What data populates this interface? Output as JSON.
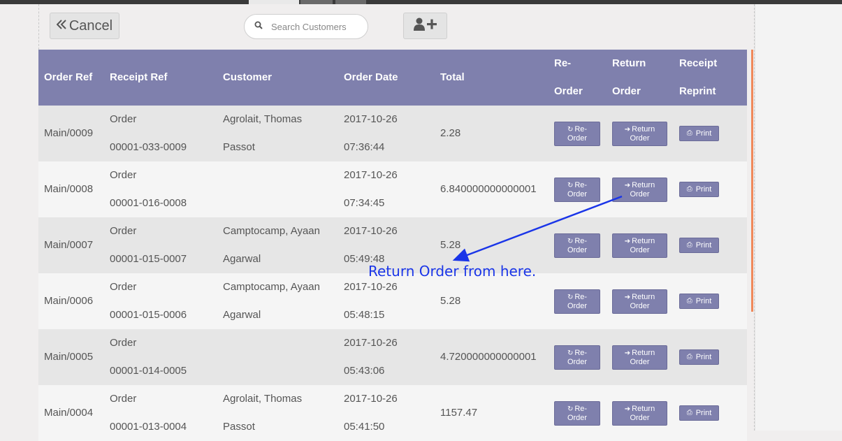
{
  "toolbar": {
    "cancel_label": "Cancel",
    "search_placeholder": "Search Customers",
    "search_value": ""
  },
  "icons": {
    "cancel": "double-chevron-left-icon",
    "search": "search-icon",
    "add_user": "user-plus-icon",
    "reorder": "refresh-icon",
    "return": "sign-in-icon",
    "print": "print-icon"
  },
  "colors": {
    "header_bg": "#7f80ad",
    "row_odd": "#e6e6e6",
    "row_even": "#f5f5f5",
    "annotation": "#1a35e8",
    "accent_bar": "#f0885a"
  },
  "table": {
    "headers": {
      "order_ref": "Order Ref",
      "receipt_ref": "Receipt Ref",
      "customer": "Customer",
      "order_date": "Order Date",
      "total": "Total",
      "reorder_1": "Re-",
      "reorder_2": "Order",
      "return_1": "Return",
      "return_2": "Order",
      "reprint_1": "Receipt",
      "reprint_2": "Reprint"
    },
    "rows": [
      {
        "order_ref": "Main/0009",
        "receipt_1": "Order",
        "receipt_2": "00001-033-0009",
        "customer_1": "Agrolait, Thomas",
        "customer_2": "Passot",
        "date_1": "2017-10-26",
        "date_2": "07:36:44",
        "total": "2.28"
      },
      {
        "order_ref": "Main/0008",
        "receipt_1": "Order",
        "receipt_2": "00001-016-0008",
        "customer_1": "",
        "customer_2": "",
        "date_1": "2017-10-26",
        "date_2": "07:34:45",
        "total": "6.840000000000001"
      },
      {
        "order_ref": "Main/0007",
        "receipt_1": "Order",
        "receipt_2": "00001-015-0007",
        "customer_1": "Camptocamp, Ayaan",
        "customer_2": "Agarwal",
        "date_1": "2017-10-26",
        "date_2": "05:49:48",
        "total": "5.28"
      },
      {
        "order_ref": "Main/0006",
        "receipt_1": "Order",
        "receipt_2": "00001-015-0006",
        "customer_1": "Camptocamp, Ayaan",
        "customer_2": "Agarwal",
        "date_1": "2017-10-26",
        "date_2": "05:48:15",
        "total": "5.28"
      },
      {
        "order_ref": "Main/0005",
        "receipt_1": "Order",
        "receipt_2": "00001-014-0005",
        "customer_1": "",
        "customer_2": "",
        "date_1": "2017-10-26",
        "date_2": "05:43:06",
        "total": "4.720000000000001"
      },
      {
        "order_ref": "Main/0004",
        "receipt_1": "Order",
        "receipt_2": "00001-013-0004",
        "customer_1": "Agrolait, Thomas",
        "customer_2": "Passot",
        "date_1": "2017-10-26",
        "date_2": "05:41:50",
        "total": "1157.47"
      }
    ],
    "buttons": {
      "reorder_1": "Re-",
      "reorder_2": "Order",
      "return_1": "Return",
      "return_2": "Order",
      "print": "Print"
    }
  },
  "annotation": {
    "text": "Return Order from here."
  }
}
